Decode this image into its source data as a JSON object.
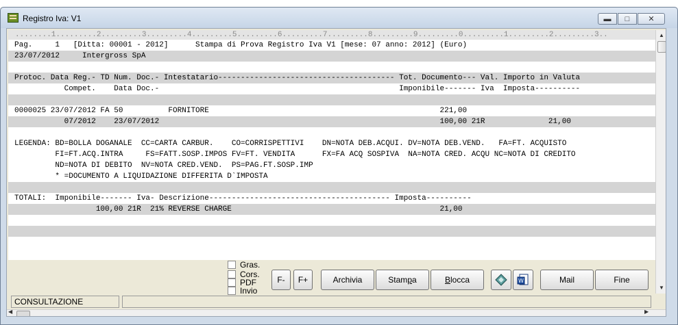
{
  "window": {
    "title": "Registro Iva: V1"
  },
  "ruler": "........1.........2.........3.........4.........5.........6.........7.........8.........9.........0.........1.........2.........3..",
  "report": {
    "lines": [
      "Pag.     1   [Ditta: 00001 - 2012]      Stampa di Prova Registro Iva V1 [mese: 07 anno: 2012] (Euro)",
      "23/07/2012     Intergross SpA",
      "",
      "Protoc. Data Reg.- TD Num. Doc.- Intestatario--------------------------------------- Tot. Documento--- Val. Importo in Valuta",
      "           Compet.    Data Doc.-                                                     Imponibile------- Iva  Imposta----------",
      "",
      "0000025 23/07/2012 FA 50          FORNITORE                                                   221,00",
      "           07/2012    23/07/2012                                                              100,00 21R              21,00",
      "",
      "LEGENDA: BD=BOLLA DOGANALE  CC=CARTA CARBUR.    CO=CORRISPETTIVI    DN=NOTA DEB.ACQUI. DV=NOTA DEB.VEND.   FA=FT. ACQUISTO",
      "         FI=FT.ACQ.INTRA     FS=FATT.SOSP.IMPOS FV=FT. VENDITA      FX=FA ACQ SOSPIVA  NA=NOTA CRED. ACQU NC=NOTA DI CREDITO",
      "         ND=NOTA DI DEBITO  NV=NOTA CRED.VEND.  PS=PAG.FT.SOSP.IMP",
      "         * =DOCUMENTO A LIQUIDAZIONE DIFFERITA D`IMPOSTA",
      "",
      "TOTALI:  Imponibile------- Iva- Descrizione---------------------------------------- Imposta----------",
      "                  100,00 21R  21% REVERSE CHARGE                                              21,00",
      "",
      "",
      ""
    ]
  },
  "checkboxes": [
    {
      "label": "Gras."
    },
    {
      "label": "Cors."
    },
    {
      "label": "PDF"
    },
    {
      "label": "Invio"
    }
  ],
  "buttons": {
    "font_minus": "F-",
    "font_plus": "F+",
    "archivia": "Archivia",
    "stampa_pre": "Stam",
    "stampa_u": "p",
    "stampa_post": "a",
    "blocca_u": "B",
    "blocca_post": "locca",
    "mail": "Mail",
    "fine": "Fine"
  },
  "status": {
    "mode": "CONSULTAZIONE",
    "message": ""
  }
}
